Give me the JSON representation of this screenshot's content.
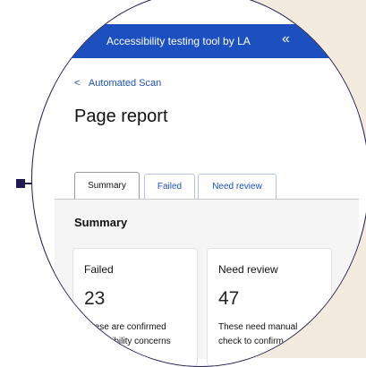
{
  "header": {
    "title": "Accessibility testing tool by LA",
    "collapse_icon": "«"
  },
  "breadcrumb": {
    "chevron": "<",
    "label": "Automated Scan"
  },
  "page_title": "Page report",
  "tabs": [
    {
      "label": "Summary",
      "active": true
    },
    {
      "label": "Failed",
      "active": false
    },
    {
      "label": "Need review",
      "active": false
    }
  ],
  "section_title": "Summary",
  "cards": [
    {
      "label": "Failed",
      "count": "23",
      "description": "These are confirmed\naccessibility concerns"
    },
    {
      "label": "Need review",
      "count": "47",
      "description": "These need manual\ncheck to confirm"
    }
  ],
  "colors": {
    "brand_blue": "#1c4fbf",
    "cream": "#f4ebdf",
    "navy": "#1f1a4f"
  }
}
